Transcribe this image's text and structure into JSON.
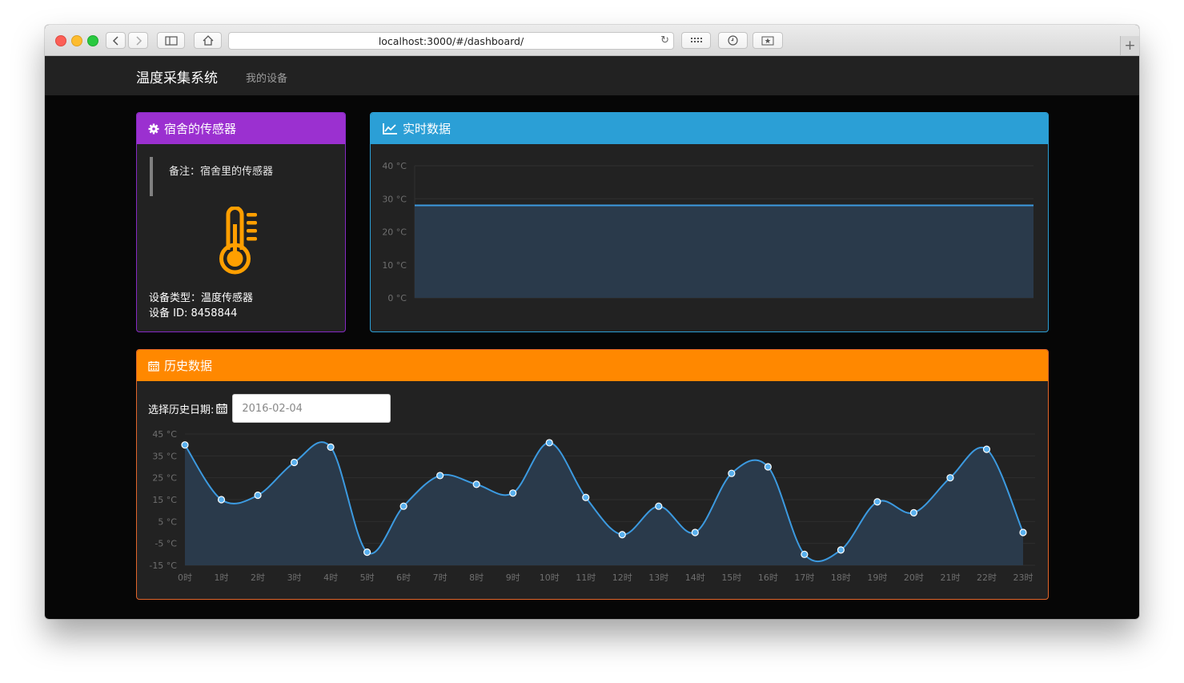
{
  "browser": {
    "url": "localhost:3000/#/dashboard/",
    "new_tab_symbol": "+"
  },
  "navbar": {
    "brand": "温度采集系统",
    "links": [
      "我的设备"
    ]
  },
  "sensor_panel": {
    "title": "宿舍的传感器",
    "note": "备注：宿舍里的传感器",
    "device_type": "设备类型：温度传感器",
    "device_id": "设备 ID: 8458844",
    "icon_color": "#ff9f00"
  },
  "realtime_panel": {
    "title": "实时数据"
  },
  "history_panel": {
    "title": "历史数据",
    "date_label": "选择历史日期:",
    "date_value": "2016-02-04"
  },
  "colors": {
    "sensor_header": "#9b30d0",
    "realtime_header": "#2b9fd6",
    "history_header": "#ff8800",
    "line": "#3c9ae0",
    "area": "#2a3a4b"
  },
  "chart_data": [
    {
      "type": "area",
      "y_ticks": [
        "40 °C",
        "30 °C",
        "20 °C",
        "10 °C",
        "0 °C"
      ],
      "ylim": [
        0,
        40
      ],
      "series": [
        {
          "values": [
            28,
            28
          ]
        }
      ],
      "grid": true
    },
    {
      "type": "line",
      "categories": [
        "0时",
        "1时",
        "2时",
        "3时",
        "4时",
        "5时",
        "6时",
        "7时",
        "8时",
        "9时",
        "10时",
        "11时",
        "12时",
        "13时",
        "14时",
        "15时",
        "16时",
        "17时",
        "18时",
        "19时",
        "20时",
        "21时",
        "22时",
        "23时"
      ],
      "y_ticks": [
        "45 °C",
        "35 °C",
        "25 °C",
        "15 °C",
        "5 °C",
        "-5 °C",
        "-15 °C"
      ],
      "ylim": [
        -15,
        45
      ],
      "series": [
        {
          "values": [
            40,
            15,
            17,
            32,
            39,
            -9,
            12,
            26,
            22,
            18,
            41,
            16,
            -1,
            12,
            0,
            27,
            30,
            -10,
            -8,
            14,
            9,
            25,
            38,
            0
          ]
        }
      ],
      "grid": true
    }
  ]
}
